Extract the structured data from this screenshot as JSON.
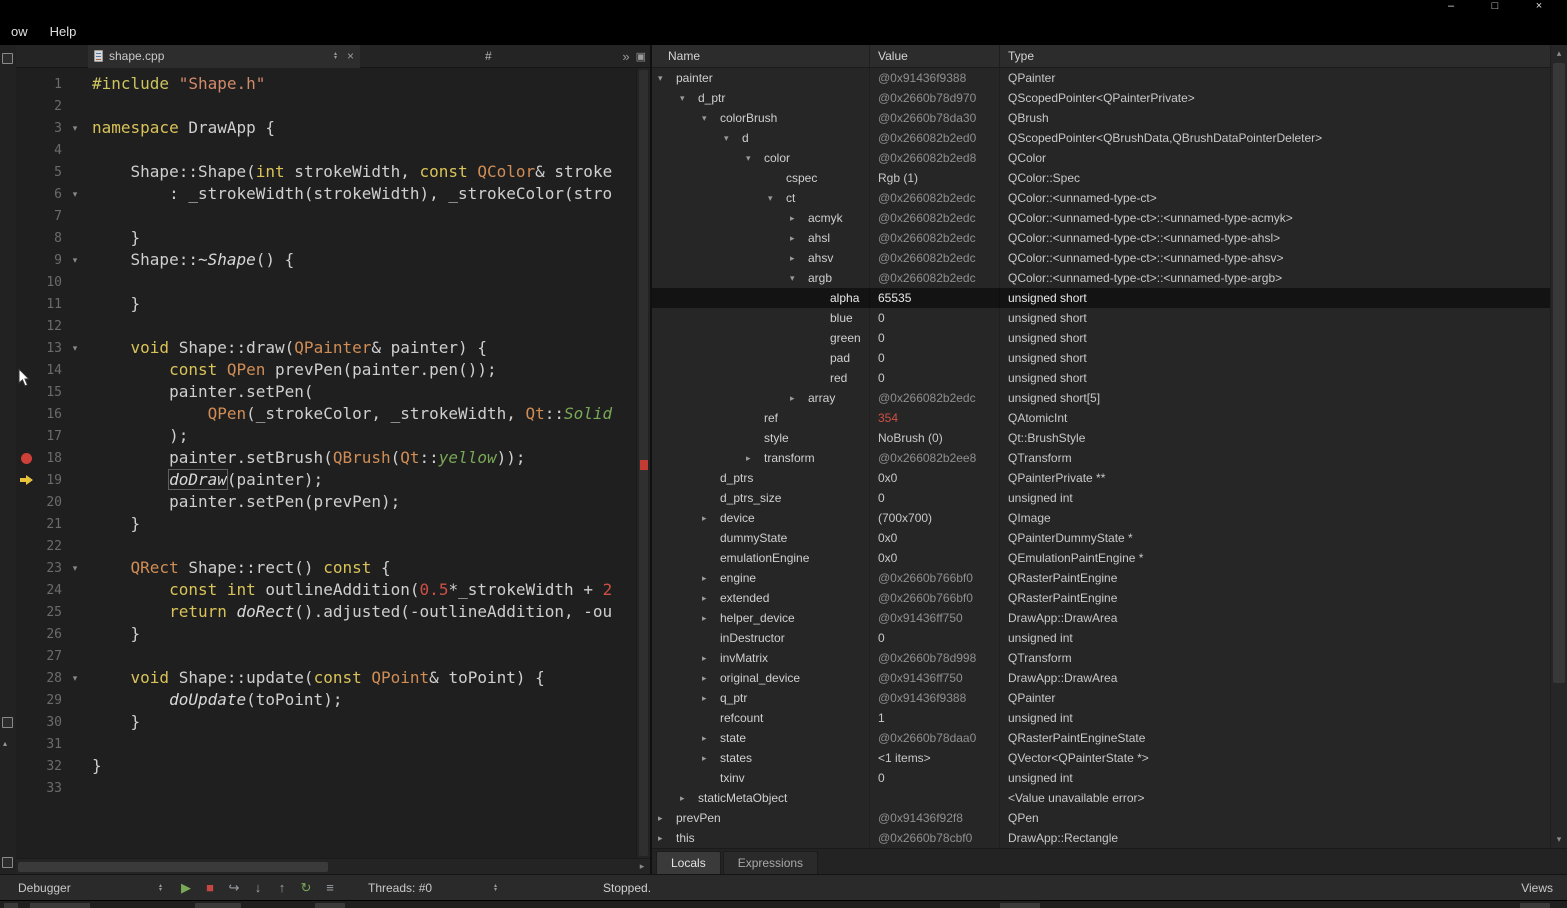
{
  "titlebar": {
    "menu": [
      "ow",
      "Help"
    ]
  },
  "icons": {
    "minimize": "–",
    "maximize": "□",
    "close": "×",
    "tab_close": "×",
    "spinner_up": "▴",
    "spinner_down": "▾",
    "tree_expanded": "▾",
    "tree_collapsed": "▸",
    "overflow": "»",
    "split_editor": "▣",
    "scroll_up": "▴",
    "scroll_down": "▾",
    "scroll_right": "▸"
  },
  "editor_tabbar": {
    "file": "shape.cpp",
    "symbol": "#"
  },
  "editor": {
    "breakpoint_line": 18,
    "current_line": 19,
    "folds": [
      3,
      6,
      9,
      13,
      23,
      28
    ],
    "lines": [
      {
        "n": 1,
        "t": [
          [
            "pp",
            "#include"
          ],
          [
            "d",
            " "
          ],
          [
            "str",
            "\"Shape.h\""
          ]
        ]
      },
      {
        "n": 2,
        "t": []
      },
      {
        "n": 3,
        "t": [
          [
            "kw",
            "namespace"
          ],
          [
            "d",
            " DrawApp {"
          ]
        ]
      },
      {
        "n": 4,
        "t": []
      },
      {
        "n": 5,
        "t": [
          [
            "d",
            "    Shape::Shape("
          ],
          [
            "kw",
            "int"
          ],
          [
            "d",
            " strokeWidth, "
          ],
          [
            "kw",
            "const"
          ],
          [
            "d",
            " "
          ],
          [
            "ty",
            "QColor"
          ],
          [
            "d",
            "& stroke"
          ]
        ]
      },
      {
        "n": 6,
        "t": [
          [
            "d",
            "        : _strokeWidth(strokeWidth), _strokeColor(stro"
          ]
        ]
      },
      {
        "n": 7,
        "t": []
      },
      {
        "n": 8,
        "t": [
          [
            "d",
            "    }"
          ]
        ]
      },
      {
        "n": 9,
        "t": [
          [
            "d",
            "    Shape::"
          ],
          [
            "vf",
            "~Shape"
          ],
          [
            "d",
            "() {"
          ]
        ]
      },
      {
        "n": 10,
        "t": []
      },
      {
        "n": 11,
        "t": [
          [
            "d",
            "    }"
          ]
        ]
      },
      {
        "n": 12,
        "t": []
      },
      {
        "n": 13,
        "t": [
          [
            "d",
            "    "
          ],
          [
            "kw",
            "void"
          ],
          [
            "d",
            " Shape::draw("
          ],
          [
            "ty",
            "QPainter"
          ],
          [
            "d",
            "& painter) {"
          ]
        ]
      },
      {
        "n": 14,
        "t": [
          [
            "d",
            "        "
          ],
          [
            "kw",
            "const"
          ],
          [
            "d",
            " "
          ],
          [
            "ty",
            "QPen"
          ],
          [
            "d",
            " prevPen(painter.pen());"
          ]
        ]
      },
      {
        "n": 15,
        "t": [
          [
            "d",
            "        painter.setPen("
          ]
        ]
      },
      {
        "n": 16,
        "t": [
          [
            "d",
            "            "
          ],
          [
            "ty",
            "QPen"
          ],
          [
            "d",
            "(_strokeColor, _strokeWidth, "
          ],
          [
            "ty",
            "Qt"
          ],
          [
            "d",
            "::"
          ],
          [
            "en",
            "Solid"
          ]
        ]
      },
      {
        "n": 17,
        "t": [
          [
            "d",
            "        );"
          ]
        ]
      },
      {
        "n": 18,
        "t": [
          [
            "d",
            "        painter.setBrush("
          ],
          [
            "ty",
            "QBrush"
          ],
          [
            "d",
            "("
          ],
          [
            "ty",
            "Qt"
          ],
          [
            "d",
            "::"
          ],
          [
            "en",
            "yellow"
          ],
          [
            "d",
            "));"
          ]
        ]
      },
      {
        "n": 19,
        "t": [
          [
            "d",
            "        "
          ],
          [
            "vf boxed",
            "doDraw"
          ],
          [
            "d",
            "(painter);"
          ]
        ]
      },
      {
        "n": 20,
        "t": [
          [
            "d",
            "        painter.setPen(prevPen);"
          ]
        ]
      },
      {
        "n": 21,
        "t": [
          [
            "d",
            "    }"
          ]
        ]
      },
      {
        "n": 22,
        "t": []
      },
      {
        "n": 23,
        "t": [
          [
            "d",
            "    "
          ],
          [
            "ty",
            "QRect"
          ],
          [
            "d",
            " Shape::rect() "
          ],
          [
            "kw",
            "const"
          ],
          [
            "d",
            " {"
          ]
        ]
      },
      {
        "n": 24,
        "t": [
          [
            "d",
            "        "
          ],
          [
            "kw",
            "const"
          ],
          [
            "d",
            " "
          ],
          [
            "kw",
            "int"
          ],
          [
            "d",
            " outlineAddition("
          ],
          [
            "num",
            "0.5"
          ],
          [
            "d",
            "*_strokeWidth + "
          ],
          [
            "num",
            "2"
          ]
        ]
      },
      {
        "n": 25,
        "t": [
          [
            "d",
            "        "
          ],
          [
            "kw",
            "return"
          ],
          [
            "d",
            " "
          ],
          [
            "vf",
            "doRect"
          ],
          [
            "d",
            "().adjusted(-outlineAddition, -ou"
          ]
        ]
      },
      {
        "n": 26,
        "t": [
          [
            "d",
            "    }"
          ]
        ]
      },
      {
        "n": 27,
        "t": []
      },
      {
        "n": 28,
        "t": [
          [
            "d",
            "    "
          ],
          [
            "kw",
            "void"
          ],
          [
            "d",
            " Shape::update("
          ],
          [
            "kw",
            "const"
          ],
          [
            "d",
            " "
          ],
          [
            "ty",
            "QPoint"
          ],
          [
            "d",
            "& toPoint) {"
          ]
        ]
      },
      {
        "n": 29,
        "t": [
          [
            "d",
            "        "
          ],
          [
            "vf",
            "doUpdate"
          ],
          [
            "d",
            "(toPoint);"
          ]
        ]
      },
      {
        "n": 30,
        "t": [
          [
            "d",
            "    }"
          ]
        ]
      },
      {
        "n": 31,
        "t": []
      },
      {
        "n": 32,
        "t": [
          [
            "d",
            "}"
          ]
        ]
      },
      {
        "n": 33,
        "t": []
      }
    ]
  },
  "debugger": {
    "columns": [
      "Name",
      "Value",
      "Type"
    ],
    "rows": [
      {
        "name": "painter",
        "value": "@0x91436f9388",
        "type": "QPainter",
        "lvl": 0,
        "st": "e",
        "vc": "dim"
      },
      {
        "name": "d_ptr",
        "value": "@0x2660b78d970",
        "type": "QScopedPointer<QPainterPrivate>",
        "lvl": 1,
        "st": "e",
        "vc": "dim"
      },
      {
        "name": "colorBrush",
        "value": "@0x2660b78da30",
        "type": "QBrush",
        "lvl": 2,
        "st": "e",
        "vc": "dim"
      },
      {
        "name": "d",
        "value": "@0x266082b2ed0",
        "type": "QScopedPointer<QBrushData,QBrushDataPointerDeleter>",
        "lvl": 3,
        "st": "e",
        "vc": "dim"
      },
      {
        "name": "color",
        "value": "@0x266082b2ed8",
        "type": "QColor",
        "lvl": 4,
        "st": "e",
        "vc": "dim"
      },
      {
        "name": "cspec",
        "value": "Rgb (1)",
        "type": "QColor::Spec",
        "lvl": 5,
        "st": "l"
      },
      {
        "name": "ct",
        "value": "@0x266082b2edc",
        "type": "QColor::<unnamed-type-ct>",
        "lvl": 5,
        "st": "e",
        "vc": "dim"
      },
      {
        "name": "acmyk",
        "value": "@0x266082b2edc",
        "type": "QColor::<unnamed-type-ct>::<unnamed-type-acmyk>",
        "lvl": 6,
        "st": "c",
        "vc": "dim"
      },
      {
        "name": "ahsl",
        "value": "@0x266082b2edc",
        "type": "QColor::<unnamed-type-ct>::<unnamed-type-ahsl>",
        "lvl": 6,
        "st": "c",
        "vc": "dim"
      },
      {
        "name": "ahsv",
        "value": "@0x266082b2edc",
        "type": "QColor::<unnamed-type-ct>::<unnamed-type-ahsv>",
        "lvl": 6,
        "st": "c",
        "vc": "dim"
      },
      {
        "name": "argb",
        "value": "@0x266082b2edc",
        "type": "QColor::<unnamed-type-ct>::<unnamed-type-argb>",
        "lvl": 6,
        "st": "e",
        "vc": "dim"
      },
      {
        "name": "alpha",
        "value": "65535",
        "type": "unsigned short",
        "lvl": 7,
        "st": "l",
        "sel": true
      },
      {
        "name": "blue",
        "value": "0",
        "type": "unsigned short",
        "lvl": 7,
        "st": "l"
      },
      {
        "name": "green",
        "value": "0",
        "type": "unsigned short",
        "lvl": 7,
        "st": "l"
      },
      {
        "name": "pad",
        "value": "0",
        "type": "unsigned short",
        "lvl": 7,
        "st": "l"
      },
      {
        "name": "red",
        "value": "0",
        "type": "unsigned short",
        "lvl": 7,
        "st": "l"
      },
      {
        "name": "array",
        "value": "@0x266082b2edc",
        "type": "unsigned short[5]",
        "lvl": 6,
        "st": "c",
        "vc": "dim"
      },
      {
        "name": "ref",
        "value": "354",
        "type": "QAtomicInt",
        "lvl": 4,
        "st": "l",
        "vc": "red"
      },
      {
        "name": "style",
        "value": "NoBrush (0)",
        "type": "Qt::BrushStyle",
        "lvl": 4,
        "st": "l"
      },
      {
        "name": "transform",
        "value": "@0x266082b2ee8",
        "type": "QTransform",
        "lvl": 4,
        "st": "c",
        "vc": "dim"
      },
      {
        "name": "d_ptrs",
        "value": "0x0",
        "type": "QPainterPrivate **",
        "lvl": 2,
        "st": "l"
      },
      {
        "name": "d_ptrs_size",
        "value": "0",
        "type": "unsigned int",
        "lvl": 2,
        "st": "l"
      },
      {
        "name": "device",
        "value": "(700x700)",
        "type": "QImage",
        "lvl": 2,
        "st": "c"
      },
      {
        "name": "dummyState",
        "value": "0x0",
        "type": "QPainterDummyState *",
        "lvl": 2,
        "st": "l"
      },
      {
        "name": "emulationEngine",
        "value": "0x0",
        "type": "QEmulationPaintEngine *",
        "lvl": 2,
        "st": "l"
      },
      {
        "name": "engine",
        "value": "@0x2660b766bf0",
        "type": "QRasterPaintEngine",
        "lvl": 2,
        "st": "c",
        "vc": "dim"
      },
      {
        "name": "extended",
        "value": "@0x2660b766bf0",
        "type": "QRasterPaintEngine",
        "lvl": 2,
        "st": "c",
        "vc": "dim"
      },
      {
        "name": "helper_device",
        "value": "@0x91436ff750",
        "type": "DrawApp::DrawArea",
        "lvl": 2,
        "st": "c",
        "vc": "dim"
      },
      {
        "name": "inDestructor",
        "value": "0",
        "type": "unsigned int",
        "lvl": 2,
        "st": "l"
      },
      {
        "name": "invMatrix",
        "value": "@0x2660b78d998",
        "type": "QTransform",
        "lvl": 2,
        "st": "c",
        "vc": "dim"
      },
      {
        "name": "original_device",
        "value": "@0x91436ff750",
        "type": "DrawApp::DrawArea",
        "lvl": 2,
        "st": "c",
        "vc": "dim"
      },
      {
        "name": "q_ptr",
        "value": "@0x91436f9388",
        "type": "QPainter",
        "lvl": 2,
        "st": "c",
        "vc": "dim"
      },
      {
        "name": "refcount",
        "value": "1",
        "type": "unsigned int",
        "lvl": 2,
        "st": "l"
      },
      {
        "name": "state",
        "value": "@0x2660b78daa0",
        "type": "QRasterPaintEngineState",
        "lvl": 2,
        "st": "c",
        "vc": "dim"
      },
      {
        "name": "states",
        "value": "<1 items>",
        "type": "QVector<QPainterState *>",
        "lvl": 2,
        "st": "c"
      },
      {
        "name": "txinv",
        "value": "0",
        "type": "unsigned int",
        "lvl": 2,
        "st": "l"
      },
      {
        "name": "staticMetaObject",
        "value": "",
        "type": "<Value unavailable error>",
        "lvl": 1,
        "st": "c"
      },
      {
        "name": "prevPen",
        "value": "@0x91436f92f8",
        "type": "QPen",
        "lvl": 0,
        "st": "c",
        "vc": "dim"
      },
      {
        "name": "this",
        "value": "@0x2660b78cbf0",
        "type": "DrawApp::Rectangle",
        "lvl": 0,
        "st": "c",
        "vc": "dim"
      }
    ],
    "tabs": [
      "Locals",
      "Expressions"
    ],
    "active_tab": "Locals"
  },
  "statusbar": {
    "debugger_label": "Debugger",
    "threads_label": "Threads: #0",
    "status_text": "Stopped.",
    "views_label": "Views",
    "icons": [
      {
        "name": "continue-icon",
        "glyph": "▶",
        "color": "#79a857"
      },
      {
        "name": "stop-icon",
        "glyph": "■",
        "color": "#c4483f"
      },
      {
        "name": "step-over-icon",
        "glyph": "↪",
        "color": "#9aa0a6"
      },
      {
        "name": "step-into-icon",
        "glyph": "↓",
        "color": "#9aa0a6"
      },
      {
        "name": "step-out-icon",
        "glyph": "↑",
        "color": "#9aa0a6"
      },
      {
        "name": "restart-icon",
        "glyph": "↻",
        "color": "#79a857"
      },
      {
        "name": "instruction-mode-icon",
        "glyph": "≡",
        "color": "#9aa0a6"
      }
    ]
  },
  "colors": {
    "breakpoint": "#cf4038",
    "current_line_arrow": "#e8c33c",
    "error_value": "#cf4f44",
    "selection_bg": "#131313"
  }
}
